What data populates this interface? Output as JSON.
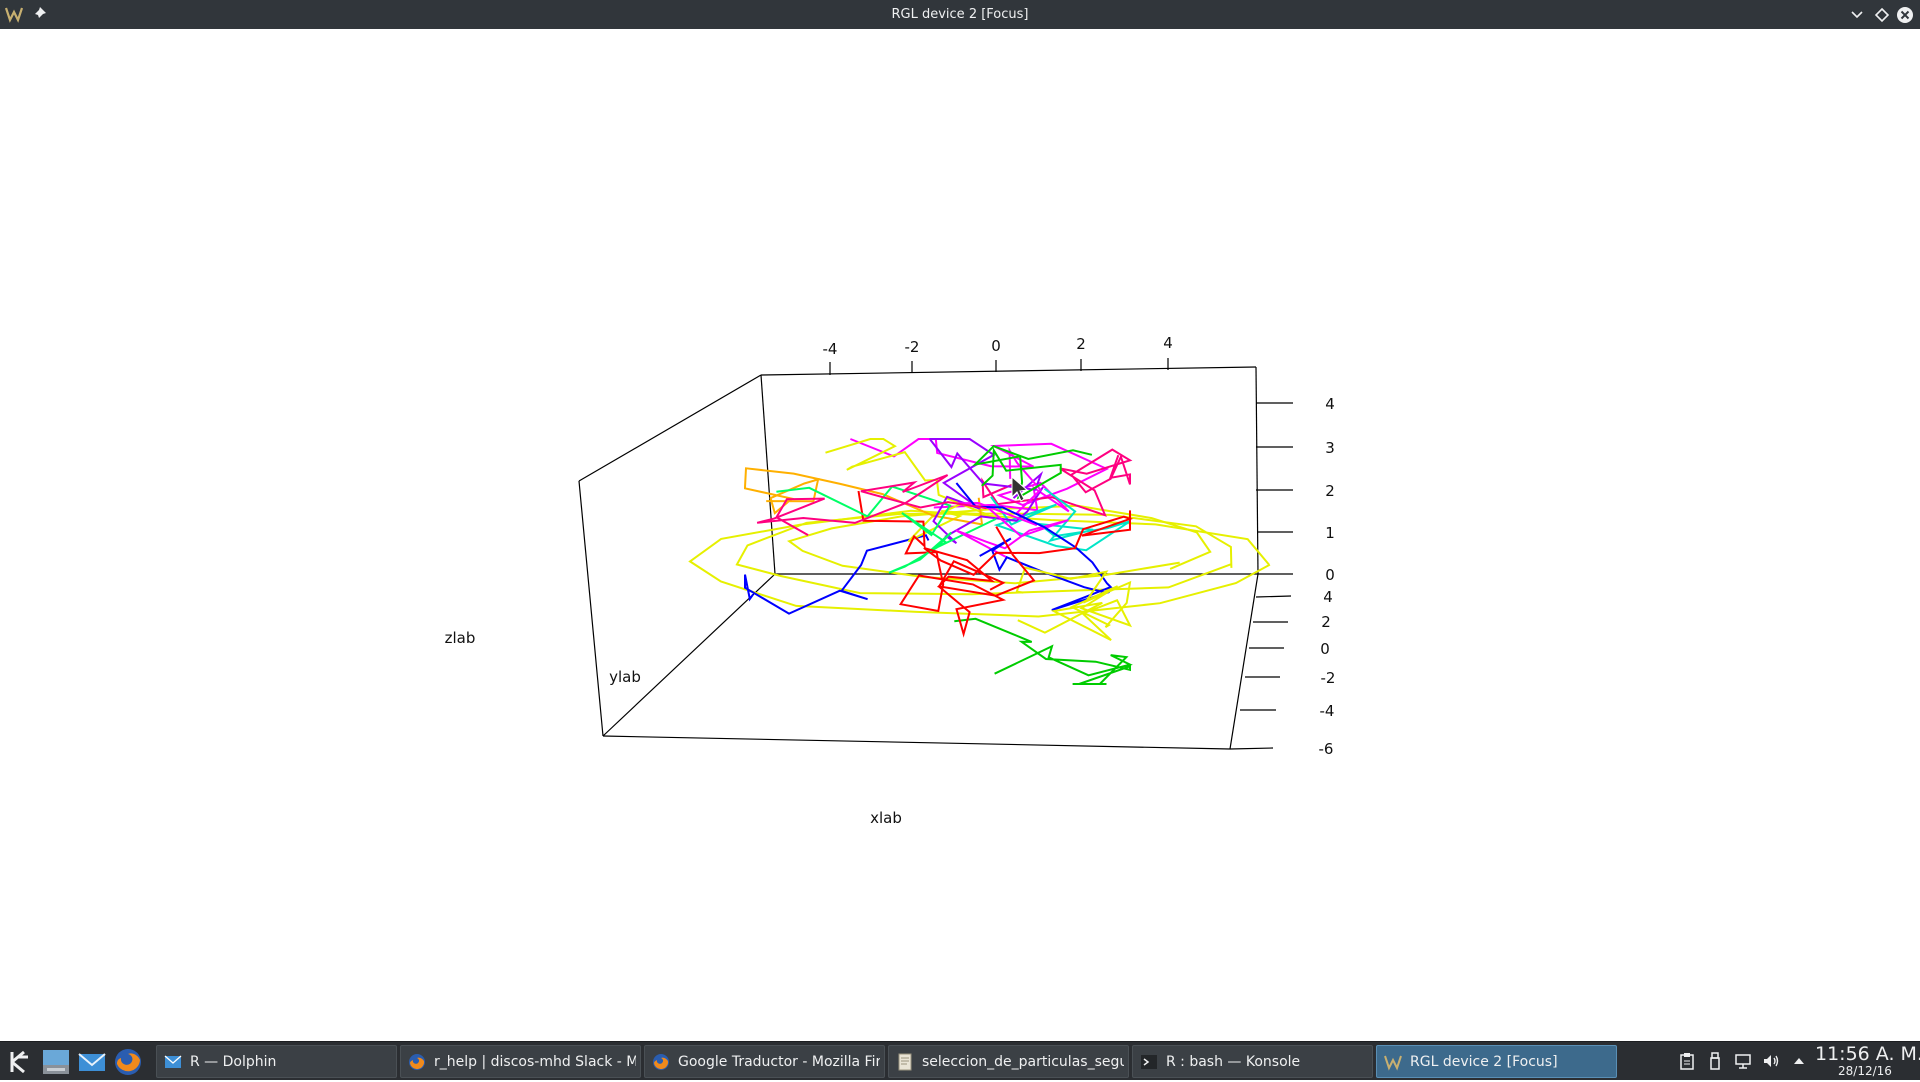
{
  "window": {
    "title": "RGL device 2 [Focus]"
  },
  "plot": {
    "x_label": "xlab",
    "y_label": "ylab",
    "z_label": "zlab",
    "x_ticks": [
      "-4",
      "-2",
      "0",
      "2",
      "4"
    ],
    "y_ticks": [
      "4",
      "2",
      "0",
      "-2",
      "-4",
      "-6"
    ],
    "z_ticks": [
      "4",
      "3",
      "2",
      "1",
      "0"
    ],
    "series_colors": [
      "#ff00ff",
      "#0000ff",
      "#00cc00",
      "#e6f000",
      "#ff0080",
      "#ff0000",
      "#00e5c8",
      "#ffb000",
      "#9900ff",
      "#00ff66"
    ]
  },
  "taskbar": {
    "launchers": [
      {
        "icon": "kde-menu-icon"
      },
      {
        "icon": "file-manager-icon"
      },
      {
        "icon": "mail-icon"
      },
      {
        "icon": "firefox-icon"
      }
    ],
    "tasks": [
      {
        "label": "R — Dolphin",
        "icon": "dolphin-icon"
      },
      {
        "label": "r_help | discos-mhd Slack - Mozilla Firefox",
        "icon": "firefox-icon"
      },
      {
        "label": "Google Traductor - Mozilla Firefox",
        "icon": "firefox-icon"
      },
      {
        "label": "seleccion_de_particulas_segun",
        "icon": "document-icon"
      },
      {
        "label": "R : bash — Konsole",
        "icon": "terminal-icon"
      },
      {
        "label": "RGL device 2 [Focus]",
        "icon": "rgl-icon"
      }
    ],
    "tray": [
      "clipboard-icon",
      "usb-device-icon",
      "network-icon",
      "volume-icon",
      "expand-arrow-icon"
    ],
    "clock_time": "11:56 A. M.",
    "clock_date": "28/12/16"
  }
}
